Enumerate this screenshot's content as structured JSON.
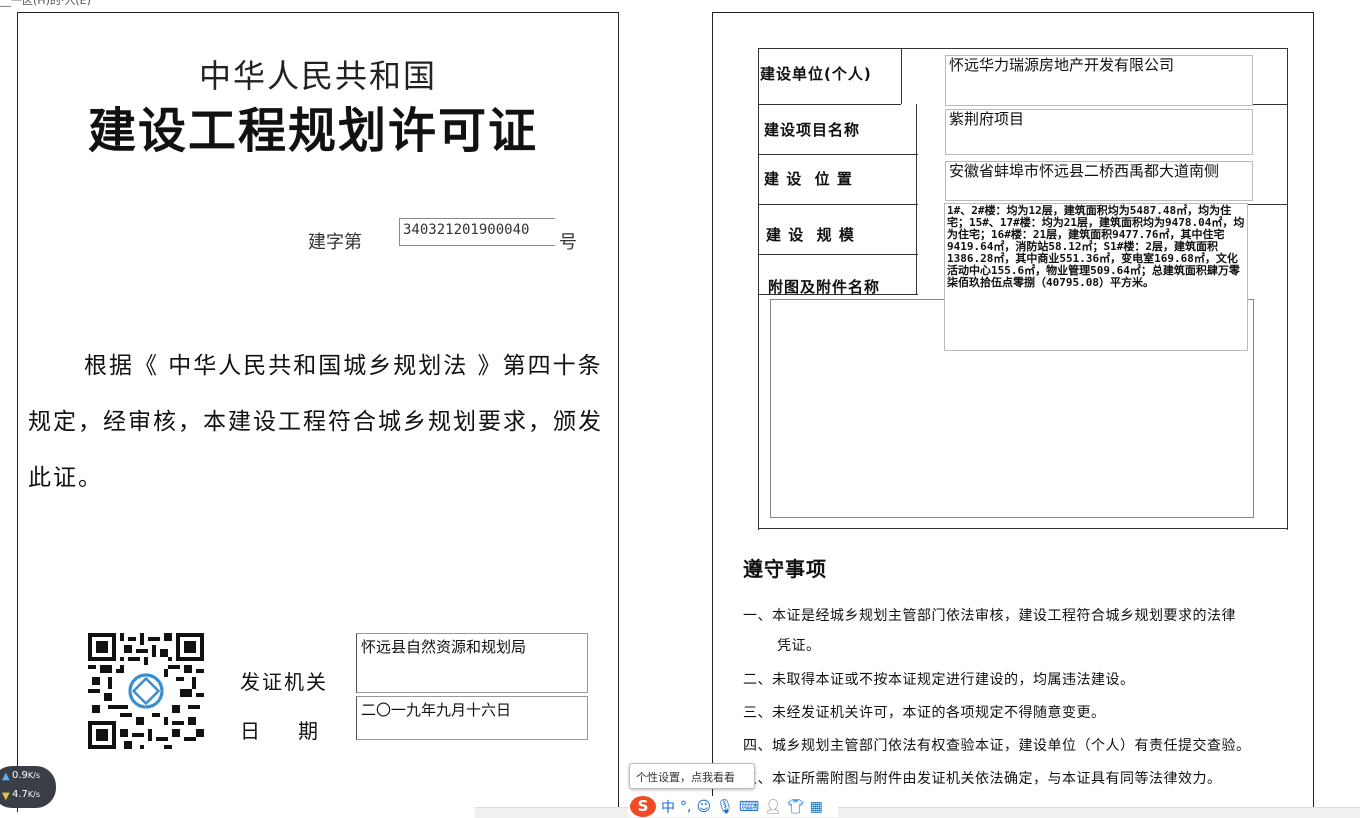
{
  "page": {
    "cut_header": "__一区(H)的·入(E)"
  },
  "left": {
    "country": "中华人民共和国",
    "title": "建设工程规划许可证",
    "permit_prefix": "建字第",
    "permit_number": "340321201900040",
    "permit_suffix": "号",
    "basis_text": "根据《 中华人民共和国城乡规划法 》第四十条规定，经审核，本建设工程符合城乡规划要求，颁发此证。",
    "issuer_label": "发证机关",
    "issuer_value": "怀远县自然资源和规划局",
    "date_label_a": "日",
    "date_label_b": "期",
    "date_value": "二〇一九年九月十六日"
  },
  "right": {
    "rows": {
      "unit_label": "建设单位(个人)",
      "unit_value": "怀远华力瑞源房地产开发有限公司",
      "project_label": "建设项目名称",
      "project_value": "紫荆府项目",
      "location_label": "建 设  位 置",
      "location_value": "安徽省蚌埠市怀远县二桥西禹都大道南侧",
      "scale_label": "建 设  规 模",
      "scale_value": "1#、2#楼：均为12层，建筑面积均为5487.48㎡，均为住宅；15#、17#楼：均为21层，建筑面积均为9478.04㎡，均为住宅；16#楼：21层，建筑面积9477.76㎡，其中住宅9419.64㎡，消防站58.12㎡；S1#楼：2层，建筑面积1386.28㎡，其中商业551.36㎡，变电室169.68㎡，文化活动中心155.6㎡，物业管理509.64㎡；总建筑面积肆万零柒佰玖拾伍点零捌（40795.08）平方米。",
      "attach_label": "附图及附件名称"
    },
    "notice_title": "遵守事项",
    "notices": [
      "一、本证是经城乡规划主管部门依法审核，建设工程符合城乡规划要求的法律",
      "凭证。",
      "二、未取得本证或不按本证规定进行建设的，均属违法建设。",
      "三、未经发证机关许可，本证的各项规定不得随意变更。",
      "四、城乡规划主管部门依法有权查验本证，建设单位（个人）有责任提交查验。",
      "五、本证所需附图与附件由发证机关依法确定，与本证具有同等法律效力。"
    ]
  },
  "widgets": {
    "net_up": "0.9",
    "net_up_unit": "K/s",
    "net_down": "4.7",
    "net_down_unit": "K/s",
    "ime_tip": "个性设置，点我看看",
    "ime_logo": "S",
    "ime_mode": "中",
    "ime_punct": "°,",
    "icons": [
      "ime-logo-icon",
      "emoji-icon",
      "microphone-icon",
      "keyboard-icon",
      "user-icon",
      "skin-icon",
      "grid-icon"
    ]
  }
}
